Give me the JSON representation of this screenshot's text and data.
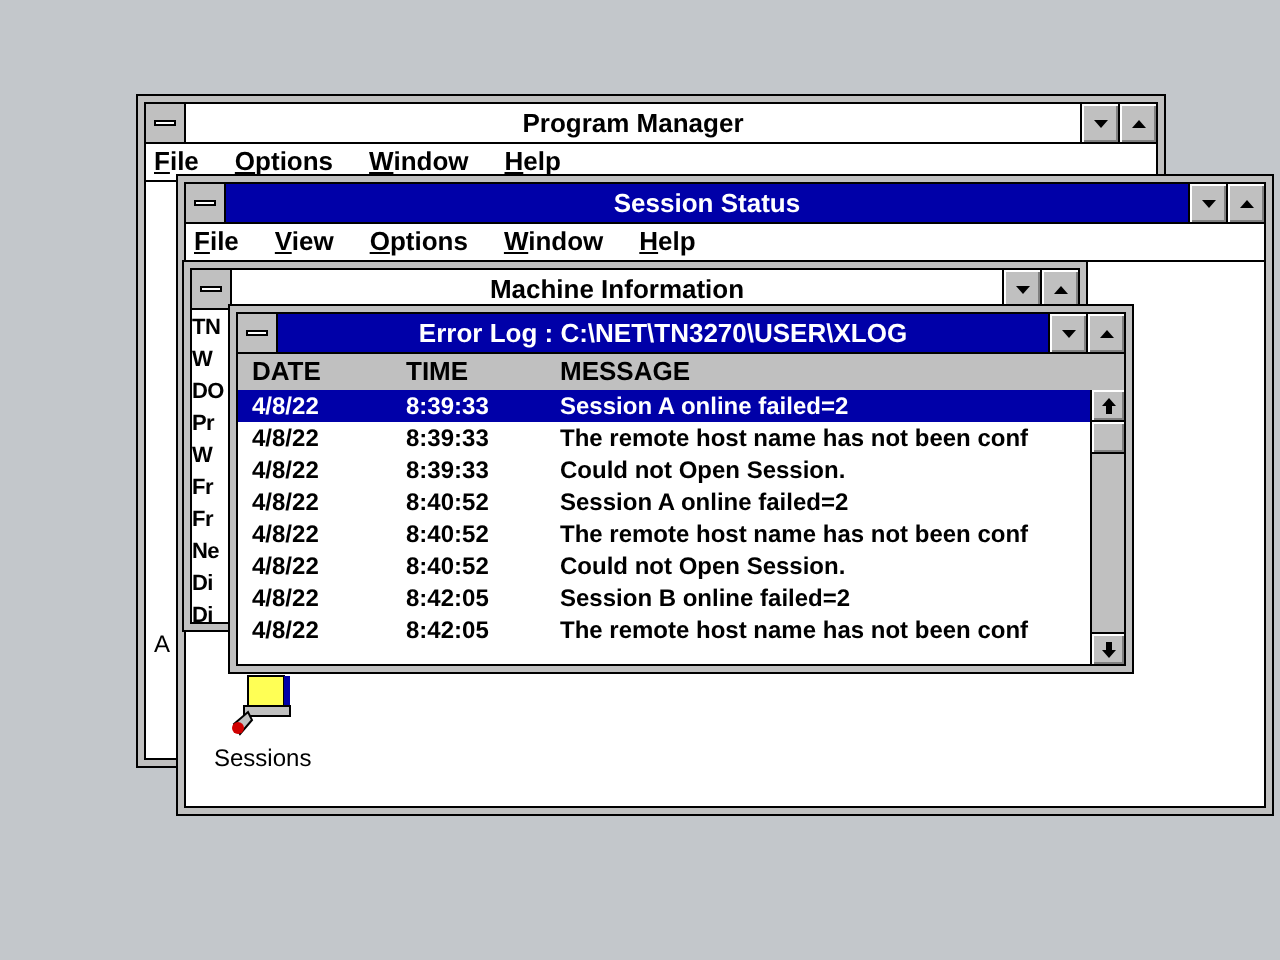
{
  "program_manager": {
    "title": "Program Manager",
    "active": false,
    "menu": [
      "File",
      "Options",
      "Window",
      "Help"
    ],
    "partial_text": "A"
  },
  "session_status": {
    "title": "Session Status",
    "active": true,
    "menu": [
      "File",
      "View",
      "Options",
      "Window",
      "Help"
    ],
    "icons": [
      {
        "label": "Sessions"
      }
    ]
  },
  "machine_information": {
    "title": "Machine Information",
    "active": false,
    "lines": [
      "TN",
      "W",
      "DO",
      "Pr",
      "W",
      "Fr",
      "Fr",
      "Ne",
      "Di",
      "Di"
    ]
  },
  "error_log": {
    "title": "Error Log : C:\\NET\\TN3270\\USER\\XLOG",
    "active": true,
    "columns": [
      "DATE",
      "TIME",
      "MESSAGE"
    ],
    "rows": [
      {
        "date": "4/8/22",
        "time": "8:39:33",
        "message": "Session A online failed=2",
        "selected": true
      },
      {
        "date": "4/8/22",
        "time": "8:39:33",
        "message": "The remote host name has not been conf",
        "selected": false
      },
      {
        "date": "4/8/22",
        "time": "8:39:33",
        "message": "Could not Open Session.",
        "selected": false
      },
      {
        "date": "4/8/22",
        "time": "8:40:52",
        "message": "Session A online failed=2",
        "selected": false
      },
      {
        "date": "4/8/22",
        "time": "8:40:52",
        "message": "The remote host name has not been conf",
        "selected": false
      },
      {
        "date": "4/8/22",
        "time": "8:40:52",
        "message": "Could not Open Session.",
        "selected": false
      },
      {
        "date": "4/8/22",
        "time": "8:42:05",
        "message": "Session B online failed=2",
        "selected": false
      },
      {
        "date": "4/8/22",
        "time": "8:42:05",
        "message": "The remote host name has not been conf",
        "selected": false
      }
    ]
  }
}
